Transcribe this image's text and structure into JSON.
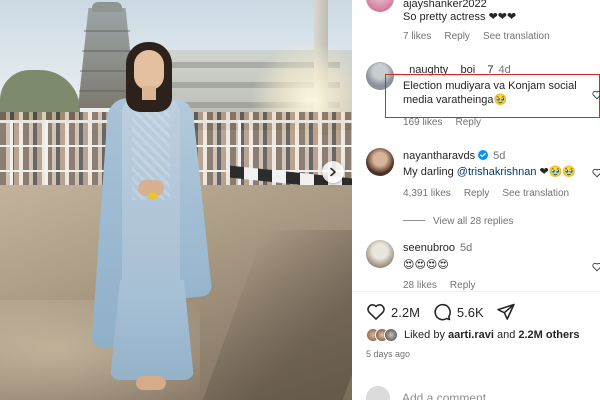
{
  "post": {
    "next_arrow": "chevron-right-icon"
  },
  "comments": [
    {
      "username": "ajayshanker2022",
      "time": "",
      "text": "So pretty actress ❤❤❤",
      "likes": "7 likes",
      "reply": "Reply",
      "translation": "See translation"
    },
    {
      "username": "_naughty__boi__7",
      "time": "4d",
      "text": "Election mudiyara va Konjam social media varatheinga🥹",
      "likes": "169 likes",
      "reply": "Reply",
      "translation": ""
    },
    {
      "username": "nayantharavds",
      "verified": true,
      "time": "5d",
      "text_prefix": "My darling ",
      "mention": "@trishakrishnan",
      "text_suffix": " ❤🥹🥹",
      "likes": "4,391 likes",
      "reply": "Reply",
      "translation": "See translation",
      "view_replies": "View all 28 replies"
    },
    {
      "username": "seenubroo",
      "time": "5d",
      "text": "😍😍😍😍",
      "likes": "28 likes",
      "reply": "Reply",
      "translation": ""
    }
  ],
  "actions": {
    "likes_count": "2.2M",
    "comments_count": "5.6K",
    "like_icon": "heart-icon",
    "comment_icon": "speech-bubble-icon",
    "share_icon": "paper-plane-icon"
  },
  "liked_by": {
    "prefix": "Liked by ",
    "user": "aarti.ravi",
    "middle": " and ",
    "others": "2.2M others"
  },
  "date": "5 days ago",
  "add_comment": {
    "placeholder": "Add a comment..."
  },
  "colors": {
    "highlight_border": "#d7262e",
    "mention": "#00376b",
    "verified": "#0095f6",
    "secondary_text": "#737373"
  }
}
